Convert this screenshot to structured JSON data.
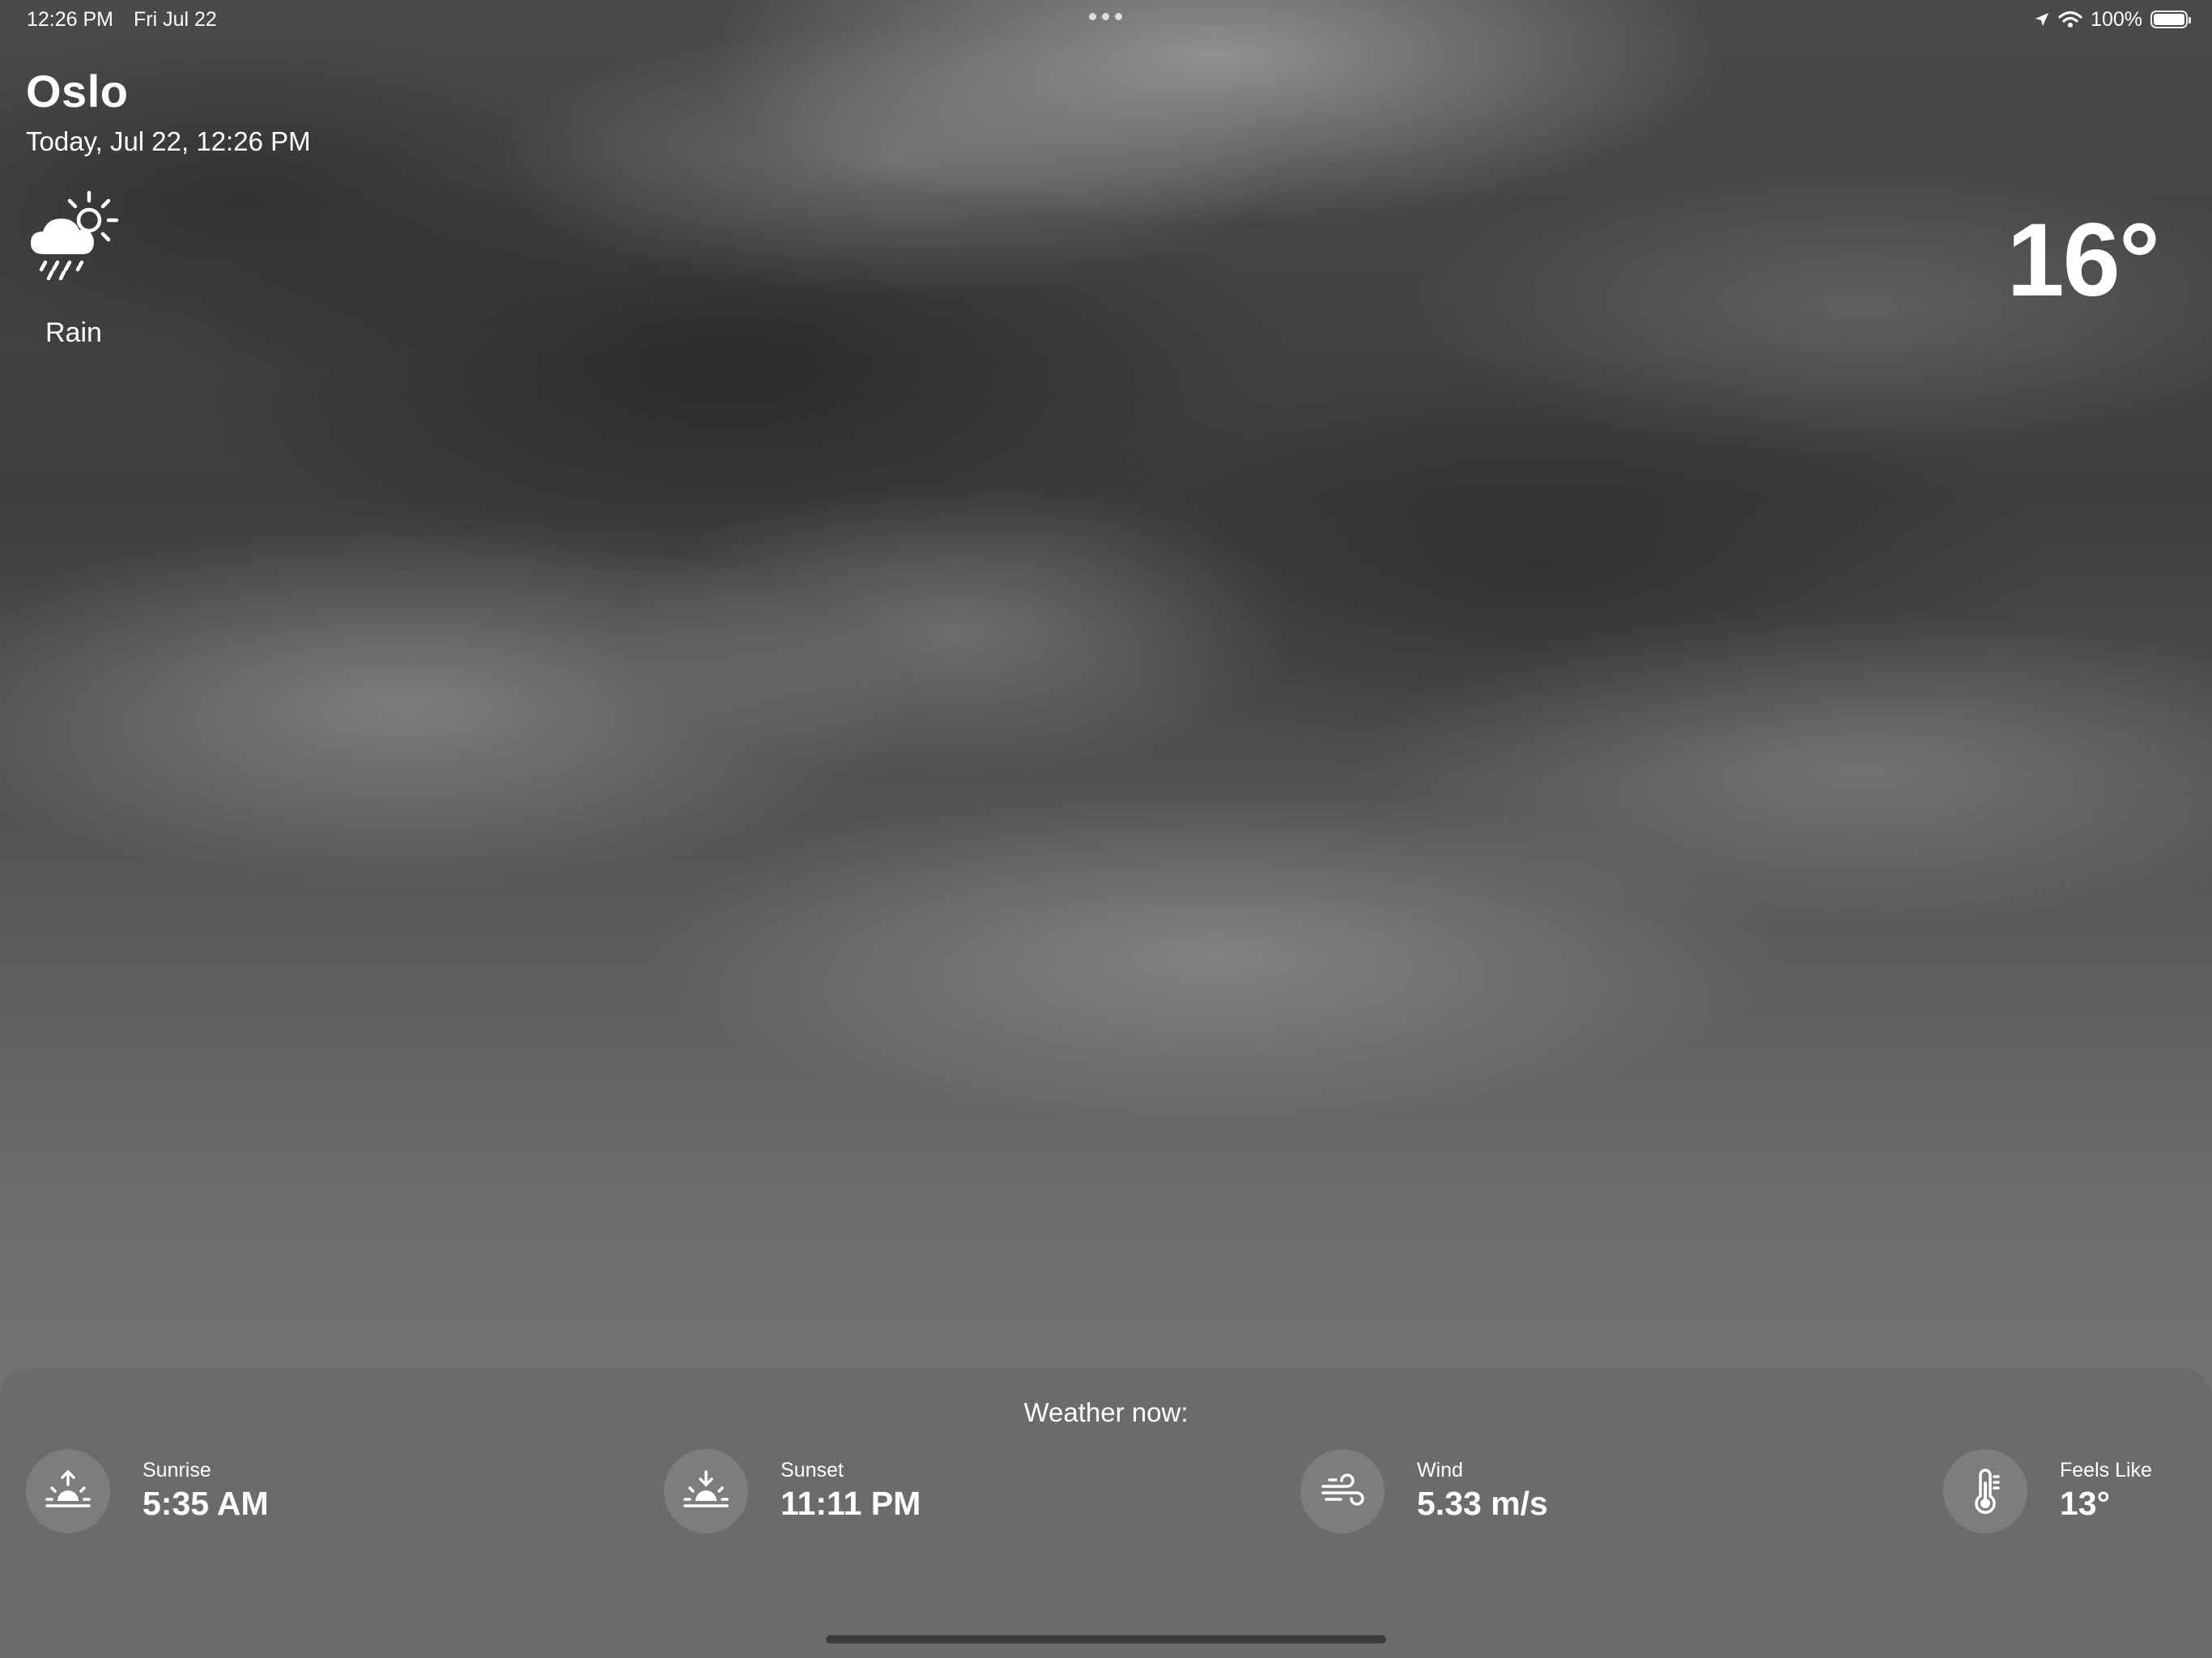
{
  "status_bar": {
    "time": "12:26 PM",
    "date": "Fri Jul 22",
    "battery": "100%",
    "battery_level": 1.0,
    "icons": [
      "location-arrow-icon",
      "wifi-icon",
      "battery-icon",
      "multitasking-dots-icon"
    ]
  },
  "header": {
    "city": "Oslo",
    "datetime": "Today, Jul 22, 12:26 PM",
    "condition": "Rain",
    "condition_icon": "cloud-sun-rain-icon",
    "temperature": "16°"
  },
  "panel": {
    "title": "Weather now:",
    "stats": [
      {
        "label": "Sunrise",
        "value": "5:35 AM",
        "icon": "sunrise-icon"
      },
      {
        "label": "Sunset",
        "value": "11:11 PM",
        "icon": "sunset-icon"
      },
      {
        "label": "Wind",
        "value": "5.33 m/s",
        "icon": "wind-icon"
      },
      {
        "label": "Feels Like",
        "value": "13°",
        "icon": "thermometer-icon"
      }
    ]
  },
  "colors": {
    "panel_background": "#6b6b6b",
    "icon_circle": "#7d7d7d",
    "text": "#ffffff"
  }
}
